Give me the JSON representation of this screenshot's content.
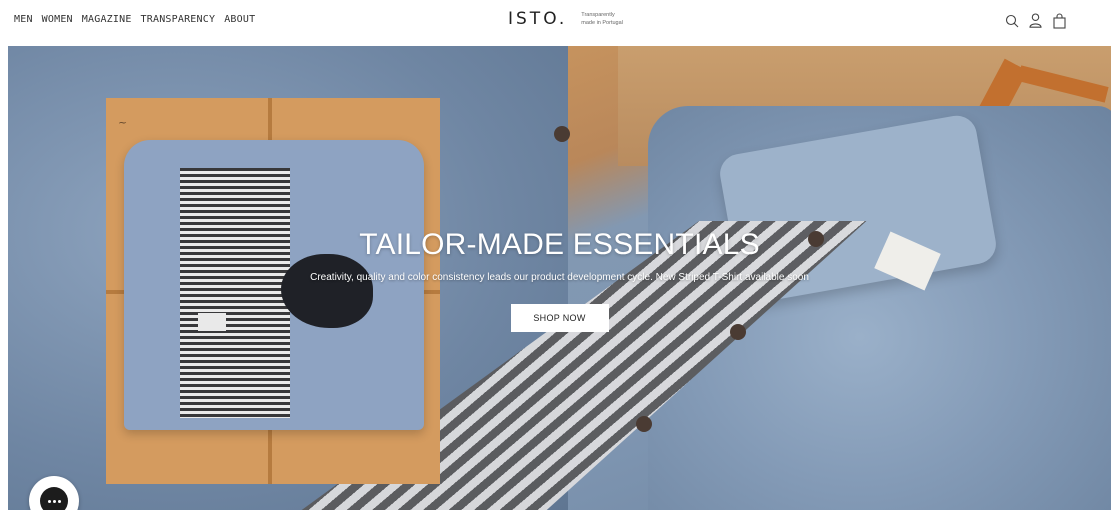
{
  "header": {
    "nav": [
      {
        "label": "MEN"
      },
      {
        "label": "WOMEN"
      },
      {
        "label": "MAGAZINE"
      },
      {
        "label": "TRANSPARENCY"
      },
      {
        "label": "ABOUT"
      }
    ],
    "logo": "ISTO.",
    "tagline_line1": "Transparently",
    "tagline_line2": "made in Portugal",
    "icons": [
      "search-icon",
      "account-icon",
      "cart-icon"
    ]
  },
  "hero": {
    "title": "TAILOR-MADE ESSENTIALS",
    "subtitle": "Creativity, quality and color consistency leads our product development cycle. New Striped T-Shirt available soon",
    "cta_label": "SHOP NOW"
  },
  "chat": {
    "icon": "chat-icon"
  },
  "colors": {
    "cta_bg": "#ffffff",
    "hero_text": "#ffffff",
    "chat_bg": "#1c1c1c"
  }
}
